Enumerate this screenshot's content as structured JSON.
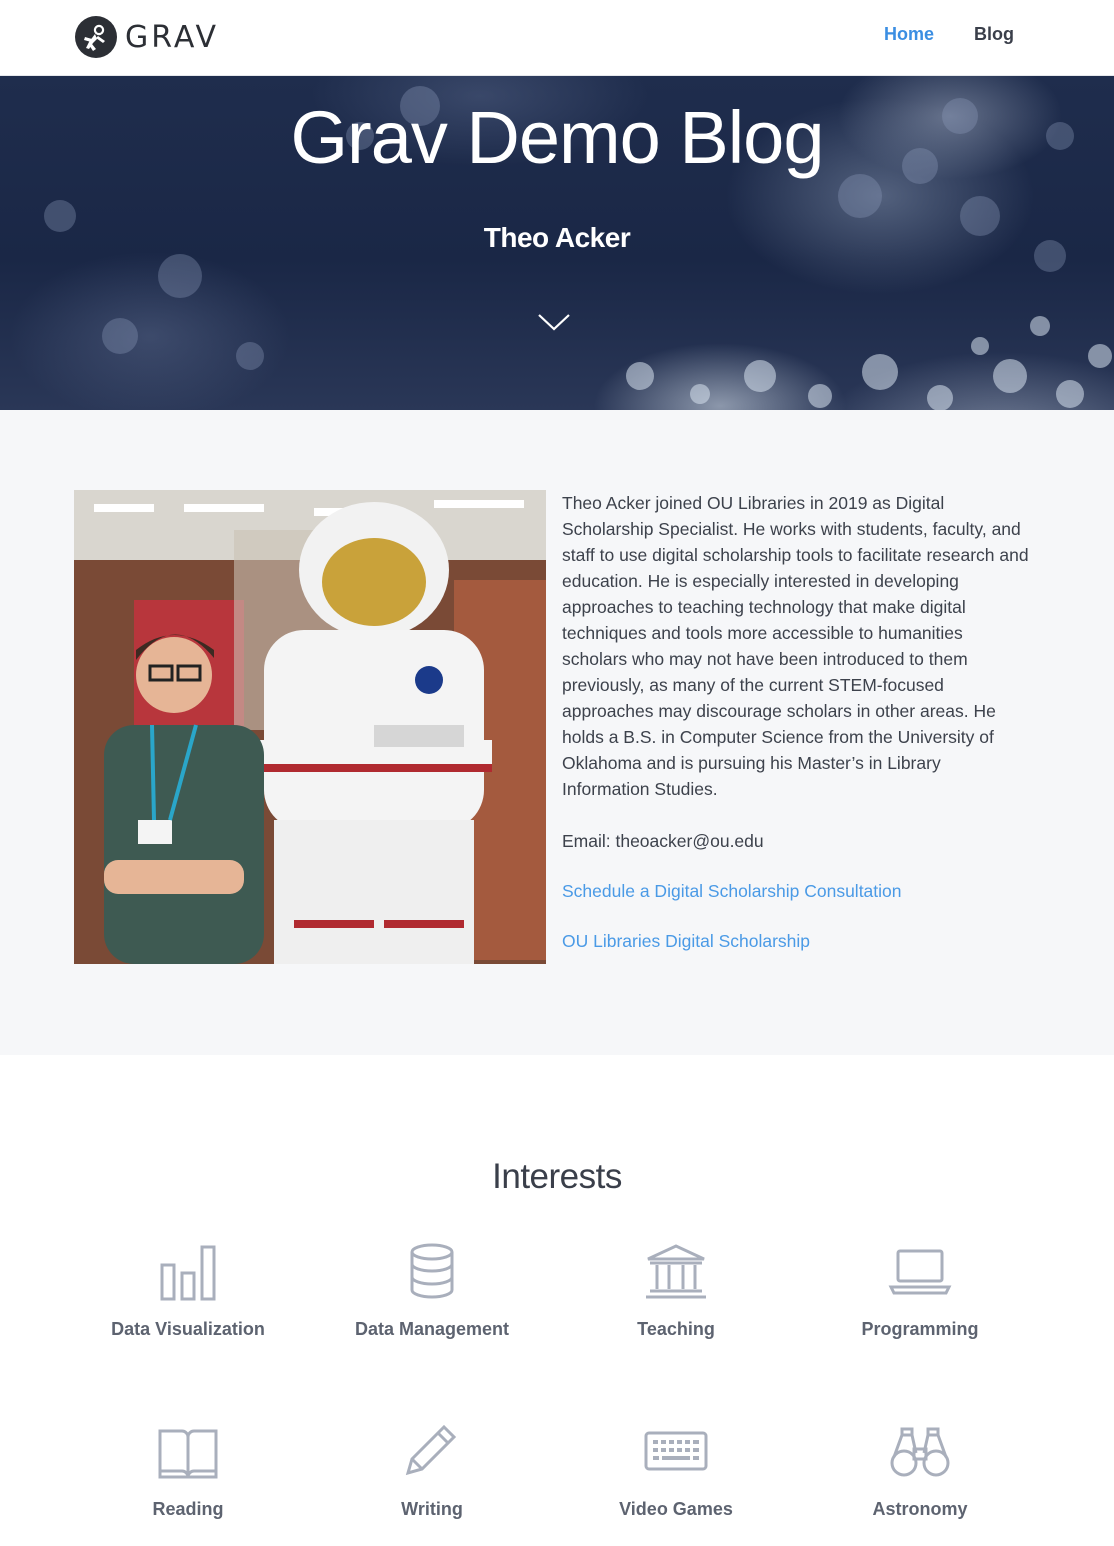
{
  "header": {
    "brand": "GRAV",
    "nav": [
      {
        "label": "Home",
        "active": true
      },
      {
        "label": "Blog",
        "active": false
      }
    ],
    "accent_color": "#3b8ee2"
  },
  "hero": {
    "title": "Grav Demo Blog",
    "subtitle": "Theo Acker",
    "scroll_icon": "chevron-down-icon"
  },
  "bio": {
    "photo_alt": "Theo Acker with an astronaut suit",
    "paragraph": "Theo Acker joined OU Libraries in 2019 as Digital Scholarship Specialist. He works with students, faculty, and staff to use digital scholarship tools to facilitate research and education. He is especially interested in developing approaches to teaching technology that make digital techniques and tools more accessible to humanities scholars who may not have been introduced to them previously, as many of the current STEM-focused approaches may discourage scholars in other areas. He holds a B.S. in Computer Science from the University of Oklahoma and is pursuing his Master’s in Library Information Studies.",
    "email": "Email: theoacker@ou.edu",
    "links": [
      {
        "label": "Schedule a Digital Scholarship Consultation"
      },
      {
        "label": "OU Libraries Digital Scholarship"
      }
    ],
    "link_color": "#4a9ae6"
  },
  "interests": {
    "title": "Interests",
    "items": [
      {
        "label": "Data Visualization",
        "icon": "bar-chart-icon"
      },
      {
        "label": "Data Management",
        "icon": "database-icon"
      },
      {
        "label": "Teaching",
        "icon": "institution-icon"
      },
      {
        "label": "Programming",
        "icon": "laptop-icon"
      },
      {
        "label": "Reading",
        "icon": "book-icon"
      },
      {
        "label": "Writing",
        "icon": "pencil-icon"
      },
      {
        "label": "Video Games",
        "icon": "keyboard-icon"
      },
      {
        "label": "Astronomy",
        "icon": "binoculars-icon"
      }
    ],
    "icon_color": "#a9afbc"
  }
}
